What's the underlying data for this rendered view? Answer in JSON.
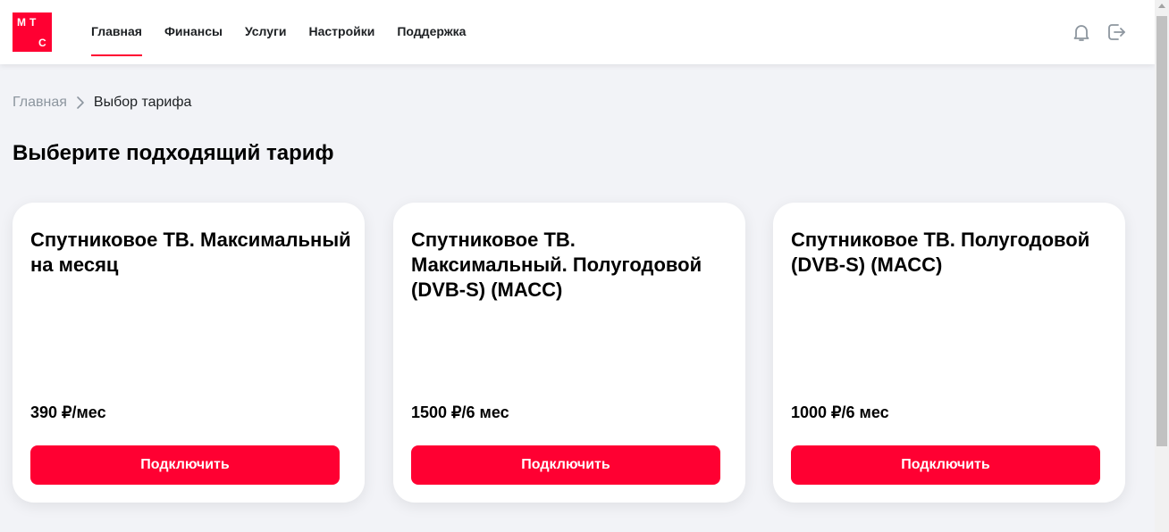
{
  "logo": {
    "letters": [
      "М",
      "Т",
      "С"
    ]
  },
  "nav": {
    "items": [
      {
        "label": "Главная",
        "active": true
      },
      {
        "label": "Финансы",
        "active": false
      },
      {
        "label": "Услуги",
        "active": false
      },
      {
        "label": "Настройки",
        "active": false
      },
      {
        "label": "Поддержка",
        "active": false
      }
    ]
  },
  "header_icons": {
    "notifications": "bell-icon",
    "logout": "logout-icon"
  },
  "breadcrumb": {
    "home": "Главная",
    "current": "Выбор тарифа"
  },
  "page_title": "Выберите подходящий тариф",
  "tariffs": [
    {
      "title": "Спутниковое ТВ. Максимальный на месяц",
      "price": "390 ₽/мес",
      "button": "Подключить"
    },
    {
      "title": "Спутниковое ТВ. Максимальный. Полугодовой (DVB-S) (МАСС)",
      "price": "1500 ₽/6 мес",
      "button": "Подключить"
    },
    {
      "title": "Спутниковое ТВ. Полугодовой (DVB-S) (МАСС)",
      "price": "1000 ₽/6 мес",
      "button": "Подключить"
    }
  ],
  "colors": {
    "accent": "#ff0032",
    "background": "#f2f3f7",
    "muted": "#8d969f"
  }
}
